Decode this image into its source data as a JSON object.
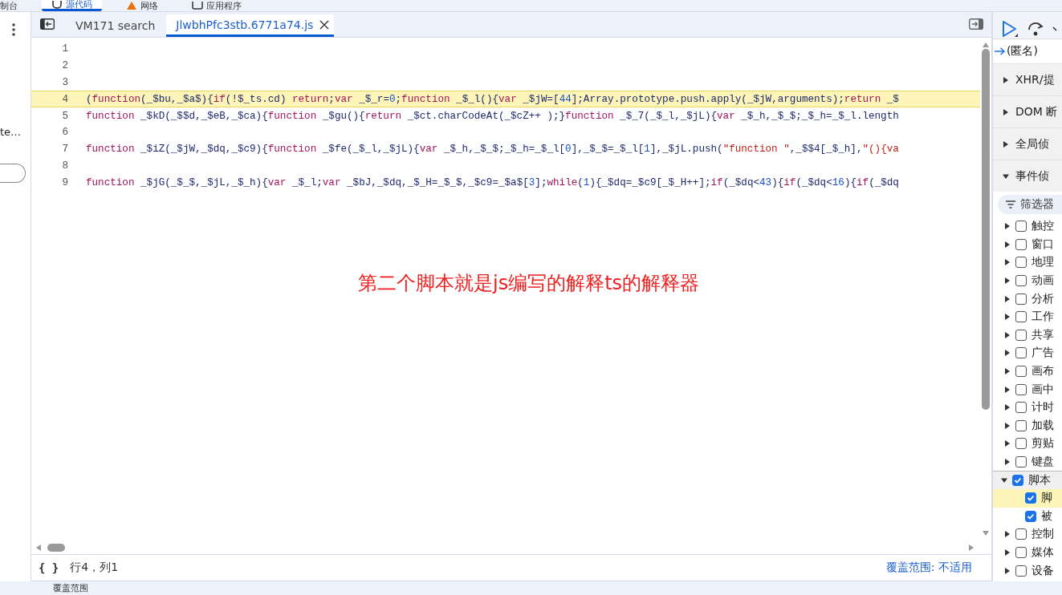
{
  "top_tabs": [
    {
      "label": "制台",
      "selected": false
    },
    {
      "label": "源代码",
      "selected": true
    },
    {
      "label": "网络",
      "selected": false
    },
    {
      "label": "应用程序",
      "selected": false
    }
  ],
  "left_panel": {
    "text": "te…"
  },
  "editor_tabs": [
    {
      "label": "VM171 search",
      "selected": false,
      "closable": false
    },
    {
      "label": "JlwbhPfc3stb.6771a74.js",
      "selected": true,
      "closable": true
    }
  ],
  "code_lines": [
    {
      "number": "1",
      "highlighted": false
    },
    {
      "number": "2",
      "highlighted": false
    },
    {
      "number": "3",
      "highlighted": false
    },
    {
      "number": "4",
      "highlighted": true,
      "tokens": [
        {
          "kind": "id",
          "text": "("
        },
        {
          "kind": "kw",
          "text": "function"
        },
        {
          "kind": "id",
          "text": "(_$bu,_$a$){"
        },
        {
          "kind": "kw",
          "text": "if"
        },
        {
          "kind": "id",
          "text": "(!$_ts.cd) "
        },
        {
          "kind": "kw",
          "text": "return"
        },
        {
          "kind": "id",
          "text": ";"
        },
        {
          "kind": "kw",
          "text": "var"
        },
        {
          "kind": "id",
          "text": " _$_r="
        },
        {
          "kind": "num",
          "text": "0"
        },
        {
          "kind": "id",
          "text": ";"
        },
        {
          "kind": "kw",
          "text": "function"
        },
        {
          "kind": "id",
          "text": " _$_l(){"
        },
        {
          "kind": "kw",
          "text": "var"
        },
        {
          "kind": "id",
          "text": " _$jW=["
        },
        {
          "kind": "num",
          "text": "44"
        },
        {
          "kind": "id",
          "text": "];Array.prototype.push.apply(_$jW,arguments);"
        },
        {
          "kind": "kw",
          "text": "return"
        },
        {
          "kind": "id",
          "text": " _$"
        }
      ]
    },
    {
      "number": "5",
      "highlighted": false,
      "tokens": [
        {
          "kind": "kw",
          "text": "function"
        },
        {
          "kind": "id",
          "text": " _$kD(_$$d,_$eB,_$ca){"
        },
        {
          "kind": "kw",
          "text": "function"
        },
        {
          "kind": "id",
          "text": " _$gu(){"
        },
        {
          "kind": "kw",
          "text": "return"
        },
        {
          "kind": "id",
          "text": " _$ct.charCodeAt(_$cZ++ );}"
        },
        {
          "kind": "kw",
          "text": "function"
        },
        {
          "kind": "id",
          "text": " _$_7(_$_l,_$jL){"
        },
        {
          "kind": "kw",
          "text": "var"
        },
        {
          "kind": "id",
          "text": " _$_h,_$_$;_$_h=_$_l.length"
        }
      ]
    },
    {
      "number": "6",
      "highlighted": false
    },
    {
      "number": "7",
      "highlighted": false,
      "tokens": [
        {
          "kind": "kw",
          "text": "function"
        },
        {
          "kind": "id",
          "text": " _$iZ(_$jW,_$dq,_$c9){"
        },
        {
          "kind": "kw",
          "text": "function"
        },
        {
          "kind": "id",
          "text": " _$fe(_$_l,_$jL){"
        },
        {
          "kind": "kw",
          "text": "var"
        },
        {
          "kind": "id",
          "text": " _$_h,_$_$;_$_h=_$_l["
        },
        {
          "kind": "num",
          "text": "0"
        },
        {
          "kind": "id",
          "text": "],_$_$=_$_l["
        },
        {
          "kind": "num",
          "text": "1"
        },
        {
          "kind": "id",
          "text": "],_$jL.push("
        },
        {
          "kind": "str",
          "text": "\"function \""
        },
        {
          "kind": "id",
          "text": ",_$$4[_$_h],"
        },
        {
          "kind": "str",
          "text": "\"(){va"
        }
      ]
    },
    {
      "number": "8",
      "highlighted": false
    },
    {
      "number": "9",
      "highlighted": false,
      "tokens": [
        {
          "kind": "kw",
          "text": "function"
        },
        {
          "kind": "id",
          "text": " _$jG(_$_$,_$jL,_$_h){"
        },
        {
          "kind": "kw",
          "text": "var"
        },
        {
          "kind": "id",
          "text": " _$_l;"
        },
        {
          "kind": "kw",
          "text": "var"
        },
        {
          "kind": "id",
          "text": " _$bJ,_$dq,_$_H=_$_$,_$c9=_$a$["
        },
        {
          "kind": "num",
          "text": "3"
        },
        {
          "kind": "id",
          "text": "];"
        },
        {
          "kind": "kw",
          "text": "while"
        },
        {
          "kind": "id",
          "text": "("
        },
        {
          "kind": "num",
          "text": "1"
        },
        {
          "kind": "id",
          "text": "){_$dq=_$c9[_$_H++];"
        },
        {
          "kind": "kw",
          "text": "if"
        },
        {
          "kind": "id",
          "text": "(_$dq<"
        },
        {
          "kind": "num",
          "text": "43"
        },
        {
          "kind": "id",
          "text": "){"
        },
        {
          "kind": "kw",
          "text": "if"
        },
        {
          "kind": "id",
          "text": "(_$dq<"
        },
        {
          "kind": "num",
          "text": "16"
        },
        {
          "kind": "id",
          "text": "){"
        },
        {
          "kind": "kw",
          "text": "if"
        },
        {
          "kind": "id",
          "text": "(_$dq"
        }
      ]
    }
  ],
  "annotation": "第二个脚本就是js编写的解释ts的解释器",
  "status_bar": {
    "braces": "{ }",
    "position": "行4，列1",
    "coverage": "覆盖范围: 不适用"
  },
  "drawer_tab": "覆盖范围",
  "debugger": {
    "call_frame": "(匿名)",
    "sections": [
      {
        "label": "XHR/提",
        "expanded": false
      },
      {
        "label": "DOM 断",
        "expanded": false
      },
      {
        "label": "全局侦",
        "expanded": false
      },
      {
        "label": "事件侦",
        "expanded": true
      }
    ],
    "filter": "筛选器",
    "listeners": [
      {
        "label": "触控",
        "checked": false,
        "expanded": false
      },
      {
        "label": "窗口",
        "checked": false,
        "expanded": false
      },
      {
        "label": "地理",
        "checked": false,
        "expanded": false
      },
      {
        "label": "动画",
        "checked": false,
        "expanded": false
      },
      {
        "label": "分析",
        "checked": false,
        "expanded": false
      },
      {
        "label": "工作",
        "checked": false,
        "expanded": false
      },
      {
        "label": "共享",
        "checked": false,
        "expanded": false
      },
      {
        "label": "广告",
        "checked": false,
        "expanded": false
      },
      {
        "label": "画布",
        "checked": false,
        "expanded": false
      },
      {
        "label": "画中",
        "checked": false,
        "expanded": false
      },
      {
        "label": "计时",
        "checked": false,
        "expanded": false
      },
      {
        "label": "加载",
        "checked": false,
        "expanded": false
      },
      {
        "label": "剪贴",
        "checked": false,
        "expanded": false
      },
      {
        "label": "键盘",
        "checked": false,
        "expanded": false
      },
      {
        "label": "脚本",
        "checked": true,
        "expanded": true,
        "children": [
          {
            "label": "脚",
            "checked": true,
            "selected": true
          },
          {
            "label": "被",
            "checked": true,
            "selected": false
          }
        ]
      },
      {
        "label": "控制",
        "checked": false,
        "expanded": false
      },
      {
        "label": "媒体",
        "checked": false,
        "expanded": false
      },
      {
        "label": "设备",
        "checked": false,
        "expanded": false
      }
    ]
  }
}
